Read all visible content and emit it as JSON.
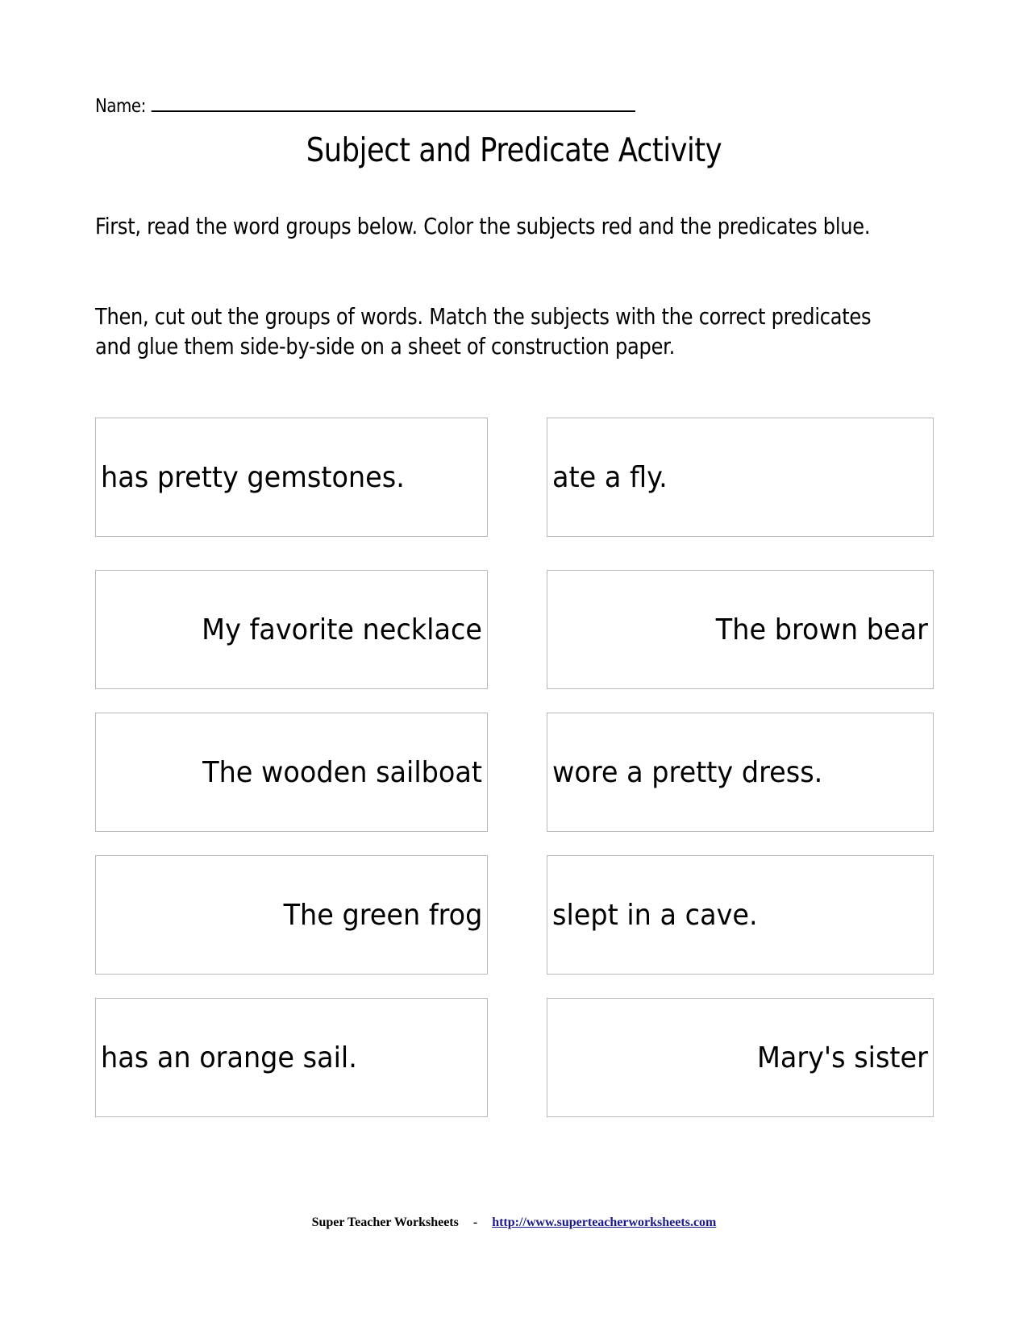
{
  "header": {
    "name_label": "Name:",
    "title": "Subject and Predicate Activity"
  },
  "instructions": [
    "First, read the word groups below.  Color the subjects red and the predicates blue.",
    "Then, cut out the groups of words.  Match the subjects with the correct predicates and glue them side-by-side on a sheet of construction paper."
  ],
  "cards": [
    {
      "text": "has pretty gemstones.",
      "type": "predicate"
    },
    {
      "text": "ate a fly.",
      "type": "predicate"
    },
    {
      "text": "My favorite necklace",
      "type": "subject"
    },
    {
      "text": "The brown bear",
      "type": "subject"
    },
    {
      "text": "The wooden sailboat",
      "type": "subject"
    },
    {
      "text": "wore a pretty dress.",
      "type": "predicate"
    },
    {
      "text": "The green frog",
      "type": "subject"
    },
    {
      "text": "slept in a cave.",
      "type": "predicate"
    },
    {
      "text": "has an orange sail.",
      "type": "predicate"
    },
    {
      "text": "Mary's sister",
      "type": "subject"
    }
  ],
  "footer": {
    "brand": "Super Teacher Worksheets",
    "separator": "-",
    "link_text": "http://www.superteacherworksheets.com",
    "link_color": "#1a1a8c"
  }
}
